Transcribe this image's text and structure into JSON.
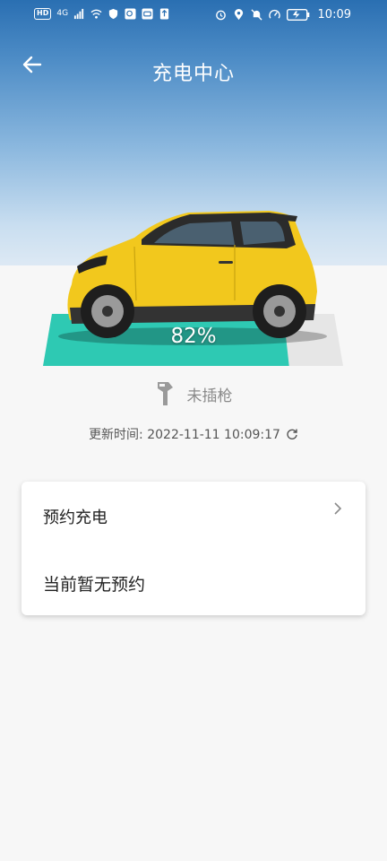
{
  "status_bar": {
    "left_chips": [
      "HD",
      "4G"
    ],
    "time": "10:09",
    "icons_left": [
      "signal-icon",
      "wifi-icon",
      "shield-icon",
      "chat-icon",
      "camera-icon",
      "upload-icon"
    ],
    "icons_right": [
      "alarm-icon",
      "location-icon",
      "mute-icon",
      "speed-icon",
      "battery-icon"
    ]
  },
  "header": {
    "title": "充电中心",
    "back_icon": "arrow-left-icon"
  },
  "vehicle": {
    "charge_percent_label": "82%",
    "charge_level": 0.82,
    "bar_color": "#2ec9b3",
    "car_color": "#f2c81d"
  },
  "plug_status": {
    "icon": "charging-gun-icon",
    "label": "未插枪"
  },
  "update": {
    "label": "更新时间: 2022-11-11 10:09:17",
    "icon": "refresh-icon"
  },
  "reservation_card": {
    "title": "预约充电",
    "chevron_icon": "chevron-right-icon",
    "status_text": "当前暂无预约"
  }
}
